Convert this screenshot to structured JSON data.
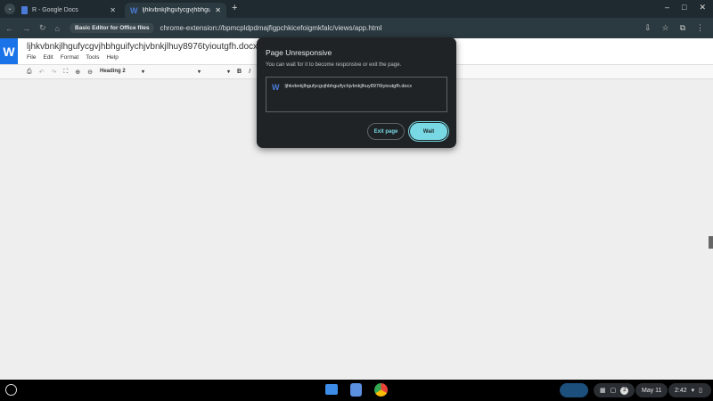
{
  "tabs": [
    {
      "label": "R - Google Docs"
    },
    {
      "label": "ljhkvbnkjlhgufycgvjhbhguifychj"
    }
  ],
  "address": {
    "chip": "Basic Editor for Office files",
    "url": "chrome-extension://bpmcpldpdmajfigpchkicefoigmkfalc/views/app.html"
  },
  "doc": {
    "logo": "W",
    "title": "ljhkvbnkjlhgufycgvjhbhguifychjvbnkjlhuy8976tyioutgfh.docx",
    "menu": [
      "File",
      "Edit",
      "Format",
      "Tools",
      "Help"
    ],
    "style": "Heading 2"
  },
  "dialog": {
    "title": "Page Unresponsive",
    "message": "You can wait for it to become responsive or exit the page.",
    "page": "ljhkvbnkjlhgufycgvjhbhguifychjvbnkjlhuy8976tyioutgfh.docx",
    "exit": "Exit page",
    "wait": "Wait"
  },
  "shelf": {
    "notifications": "2",
    "date": "May 11",
    "time": "2:42"
  },
  "colors": {
    "accent": "#78d9e4",
    "brand": "#1a73e8"
  }
}
